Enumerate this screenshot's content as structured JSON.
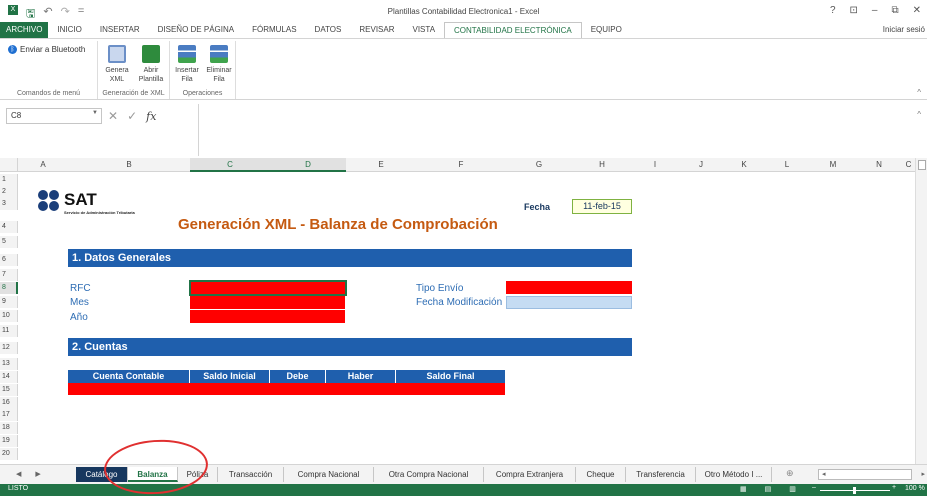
{
  "window": {
    "title": "Plantillas Contabilidad Electronica1 - Excel",
    "signin": "Iniciar sesió",
    "help": "?",
    "minimize": "–",
    "restore": "⧉",
    "close": "✕",
    "ribbon_display": "⊡"
  },
  "qat": {
    "save": "🖫",
    "undo": "↶",
    "redo": "↷",
    "custom": "="
  },
  "tabs": [
    {
      "label": "ARCHIVO"
    },
    {
      "label": "INICIO"
    },
    {
      "label": "INSERTAR"
    },
    {
      "label": "DISEÑO DE PÁGINA"
    },
    {
      "label": "FÓRMULAS"
    },
    {
      "label": "DATOS"
    },
    {
      "label": "REVISAR"
    },
    {
      "label": "VISTA"
    },
    {
      "label": "CONTABILIDAD ELECTRÓNICA"
    },
    {
      "label": "EQUIPO"
    }
  ],
  "ribbon": {
    "bluetooth": "Enviar a Bluetooth",
    "groups": [
      {
        "label": "Comandos de menú"
      },
      {
        "label": "Generación de XML"
      },
      {
        "label": "Operaciones"
      }
    ],
    "buttons": [
      {
        "label": "Genera\nXML",
        "color": "#6b8fc7"
      },
      {
        "label": "Abrir\nPlantilla",
        "color": "#2e8b3d"
      },
      {
        "label": "Insertar\nFila",
        "color": "#4a7cc2"
      },
      {
        "label": "Eliminar\nFila",
        "color": "#4a7cc2"
      }
    ]
  },
  "formula_bar": {
    "name_box": "C8",
    "formula": "",
    "fx": "fx",
    "cancel": "✕",
    "enter": "✓"
  },
  "columns": [
    "A",
    "B",
    "C",
    "D",
    "E",
    "F",
    "G",
    "H",
    "I",
    "J",
    "K",
    "L",
    "M",
    "N",
    "C"
  ],
  "rows": [
    "1",
    "2",
    "3",
    "4",
    "5",
    "6",
    "7",
    "8",
    "9",
    "10",
    "11",
    "12",
    "13",
    "14",
    "15",
    "16",
    "17",
    "18",
    "19",
    "20"
  ],
  "sheet": {
    "logo": {
      "text": "SAT",
      "subtitle": "Servicio de Administración Tributaria"
    },
    "title": "Generación XML - Balanza de Comprobación",
    "fecha_label": "Fecha",
    "fecha_value": "11-feb-15",
    "section1": "1. Datos Generales",
    "labels": {
      "rfc": "RFC",
      "mes": "Mes",
      "anio": "Año",
      "tipo_envio": "Tipo Envío",
      "fecha_mod": "Fecha Modificación"
    },
    "section2": "2. Cuentas",
    "table_headers": [
      "Cuenta Contable",
      "Saldo Inicial",
      "Debe",
      "Haber",
      "Saldo Final"
    ]
  },
  "sheet_tabs": [
    "Catálogo",
    "Balanza",
    "Póliza",
    "Transacción",
    "Compra Nacional",
    "Otra Compra Nacional",
    "Compra Extranjera",
    "Cheque",
    "Transferencia",
    "Otro Método I ..."
  ],
  "active_sheet": "Balanza",
  "status": {
    "ready": "LISTO",
    "zoom": "100 %"
  },
  "colors": {
    "excel_green": "#217346",
    "header_blue": "#1f5fad",
    "title_orange": "#c55a11",
    "required_red": "#ff0000"
  }
}
